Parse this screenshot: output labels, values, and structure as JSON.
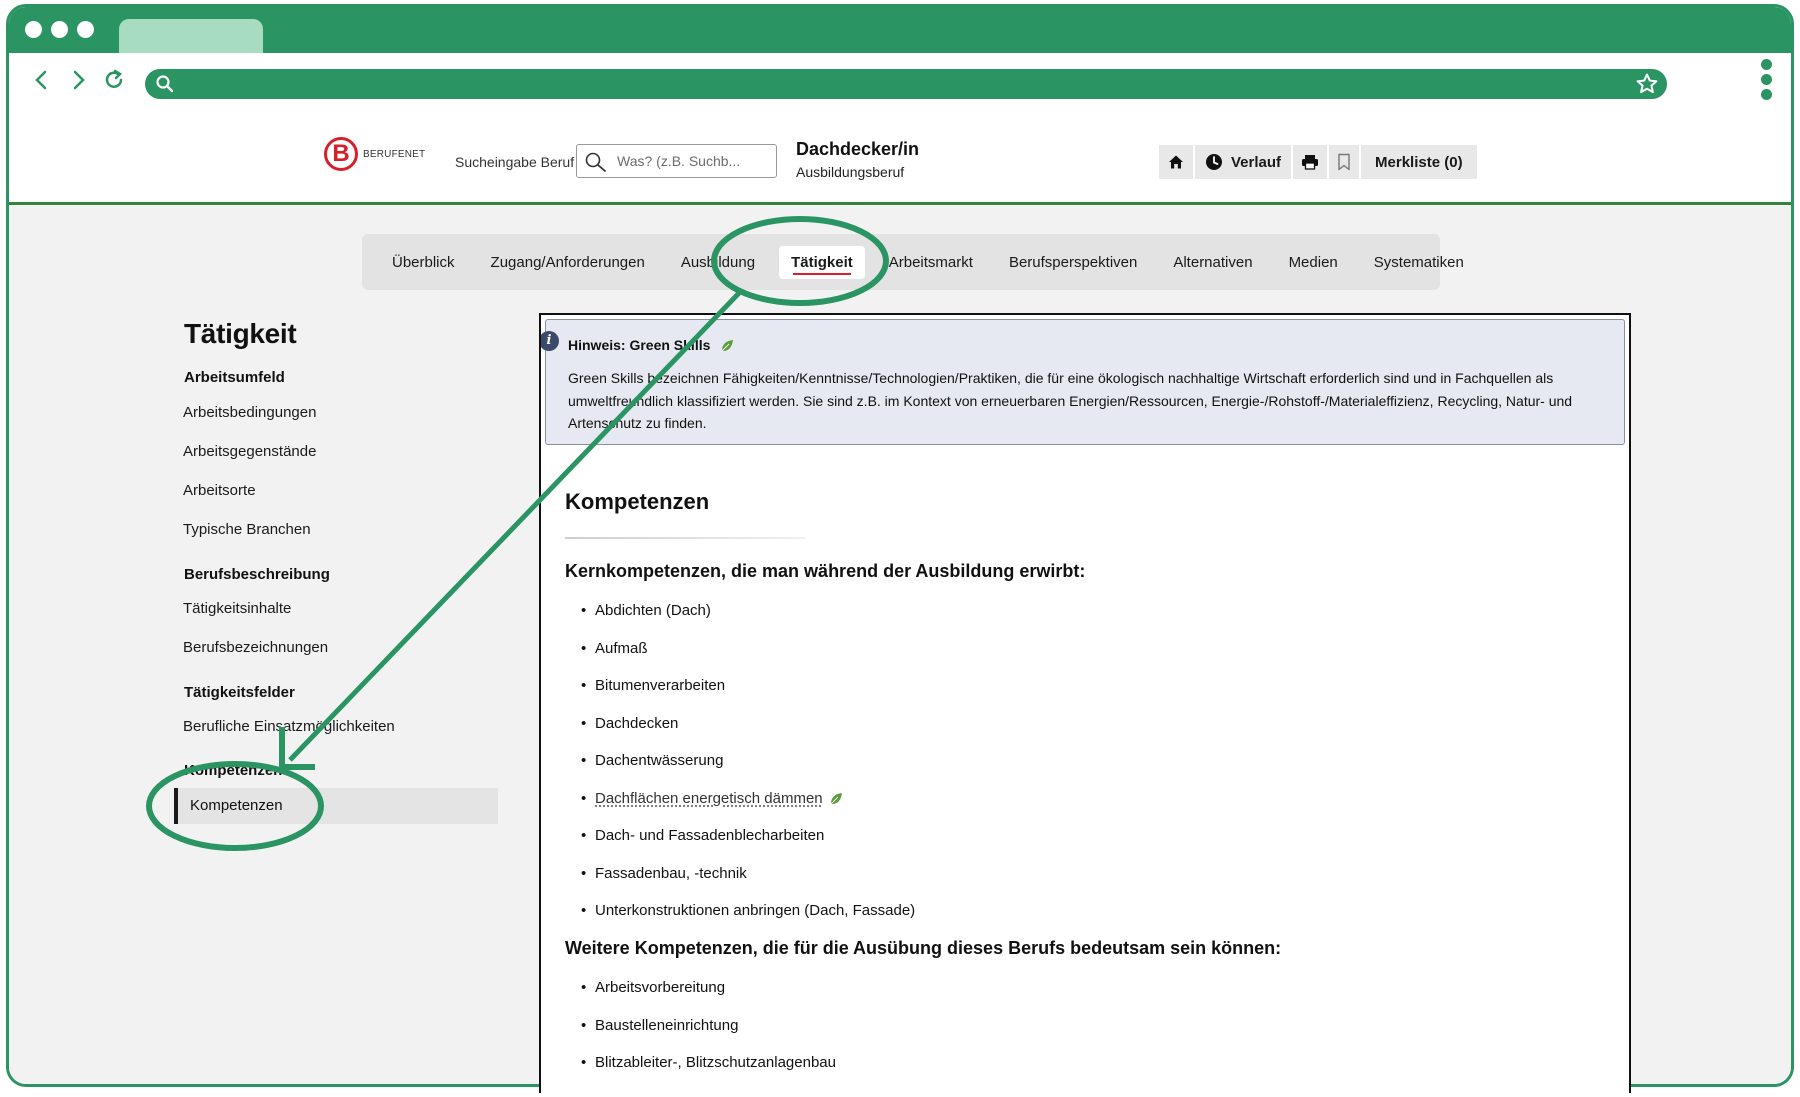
{
  "browser": {
    "back_icon": "chevron-left-icon",
    "forward_icon": "chevron-right-icon",
    "reload_icon": "reload-icon",
    "url_search_icon": "search-icon",
    "bookmark_icon": "star-icon",
    "menu_icon": "kebab-menu-icon",
    "accent_color": "#2a9462"
  },
  "header": {
    "logo_letter": "B",
    "logo_text": "BERUFENET",
    "search_label": "Sucheingabe Beruf",
    "search_placeholder": "Was? (z.B. Suchb...",
    "job_title": "Dachdecker/in",
    "job_subtitle": "Ausbildungsberuf",
    "tools": {
      "verlauf": "Verlauf",
      "merkliste": "Merkliste (0)"
    }
  },
  "tabs": [
    {
      "label": "Überblick",
      "active": false
    },
    {
      "label": "Zugang/Anforderungen",
      "active": false
    },
    {
      "label": "Ausbildung",
      "active": false
    },
    {
      "label": "Tätigkeit",
      "active": true
    },
    {
      "label": "Arbeitsmarkt",
      "active": false
    },
    {
      "label": "Berufsperspektiven",
      "active": false
    },
    {
      "label": "Alternativen",
      "active": false
    },
    {
      "label": "Medien",
      "active": false
    },
    {
      "label": "Systematiken",
      "active": false
    }
  ],
  "sidebar": {
    "title": "Tätigkeit",
    "sections": [
      {
        "heading": "Arbeitsumfeld",
        "items": [
          "Arbeitsbedingungen",
          "Arbeitsgegenstände",
          "Arbeitsorte",
          "Typische Branchen"
        ]
      },
      {
        "heading": "Berufsbeschreibung",
        "items": [
          "Tätigkeitsinhalte",
          "Berufsbezeichnungen"
        ]
      },
      {
        "heading": "Tätigkeitsfelder",
        "items": [
          "Berufliche Einsatzmöglichkeiten"
        ]
      },
      {
        "heading": "Kompetenzen",
        "items": [
          "Kompetenzen"
        ]
      }
    ],
    "active_item": "Kompetenzen"
  },
  "hint": {
    "title": "Hinweis: Green Skills",
    "body": "Green Skills bezeichnen Fähigkeiten/Kenntnisse/Technologien/Praktiken, die für eine ökologisch nachhaltige Wirtschaft erforderlich sind und in Fachquellen als umweltfreundlich klassifiziert werden. Sie sind z.B. im Kontext von erneuerbaren Energien/Ressourcen, Energie-/Rohstoff-/Materialeffizienz, Recycling, Natur- und Artenschutz zu finden."
  },
  "content": {
    "section_title": "Kompetenzen",
    "core_heading": "Kernkompetenzen, die man während der Ausbildung erwirbt:",
    "core_items": [
      {
        "label": "Abdichten (Dach)",
        "green": false
      },
      {
        "label": "Aufmaß",
        "green": false
      },
      {
        "label": "Bitumenverarbeiten",
        "green": false
      },
      {
        "label": "Dachdecken",
        "green": false
      },
      {
        "label": "Dachentwässerung",
        "green": false
      },
      {
        "label": "Dachflächen energetisch dämmen",
        "green": true
      },
      {
        "label": "Dach- und Fassadenblecharbeiten",
        "green": false
      },
      {
        "label": "Fassadenbau, -technik",
        "green": false
      },
      {
        "label": "Unterkonstruktionen anbringen (Dach, Fassade)",
        "green": false
      }
    ],
    "further_heading": "Weitere Kompetenzen, die für die Ausübung dieses Berufs bedeutsam sein können:",
    "further_items": [
      "Arbeitsvorbereitung",
      "Baustelleneinrichtung",
      "Blitzableiter-, Blitzschutzanlagenbau"
    ]
  },
  "annotation_color": "#2a9462"
}
